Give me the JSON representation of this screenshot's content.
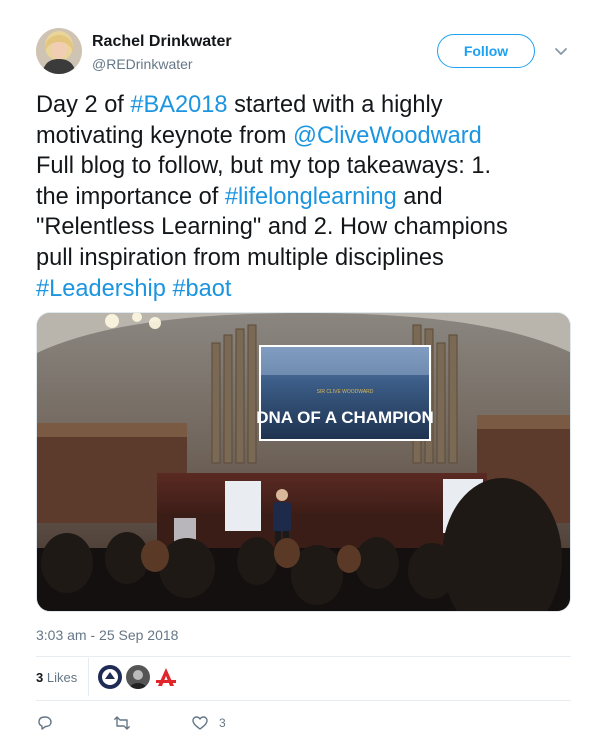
{
  "user": {
    "name": "Rachel Drinkwater",
    "handle": "@REDrinkwater",
    "follow_label": "Follow"
  },
  "tweet": {
    "line1": {
      "pre": "Day 2 of ",
      "tag": "#BA2018",
      "post": " started with a highly"
    },
    "line2": {
      "pre": "motivating keynote from ",
      "mention": "@CliveWoodward"
    },
    "line3": "Full blog to follow, but my top takeaways: 1.",
    "line4": {
      "pre": "the importance of ",
      "tag": "#lifelonglearning",
      "post": " and"
    },
    "line5": "\"Relentless Learning\" and 2. How champions",
    "line6": "pull inspiration from multiple disciplines",
    "line7": {
      "tag1": "#Leadership",
      "sep": " ",
      "tag2": "#baot"
    }
  },
  "photo": {
    "screen_subtitle": "SIR CLIVE WOODWARD",
    "screen_title": "DNA OF A CHAMPION"
  },
  "meta": {
    "timestamp": "3:03 am - 25 Sep 2018"
  },
  "likes": {
    "count": "3",
    "label": " Likes"
  },
  "actions": {
    "reply_count": "",
    "retweet_count": "",
    "like_count": "3"
  },
  "colors": {
    "link": "#1b95e0",
    "follow": "#1da1f2",
    "secondary_text": "#657786"
  },
  "icons": [
    "avatar",
    "chevron-down-icon",
    "reply-icon",
    "retweet-icon",
    "heart-icon"
  ]
}
